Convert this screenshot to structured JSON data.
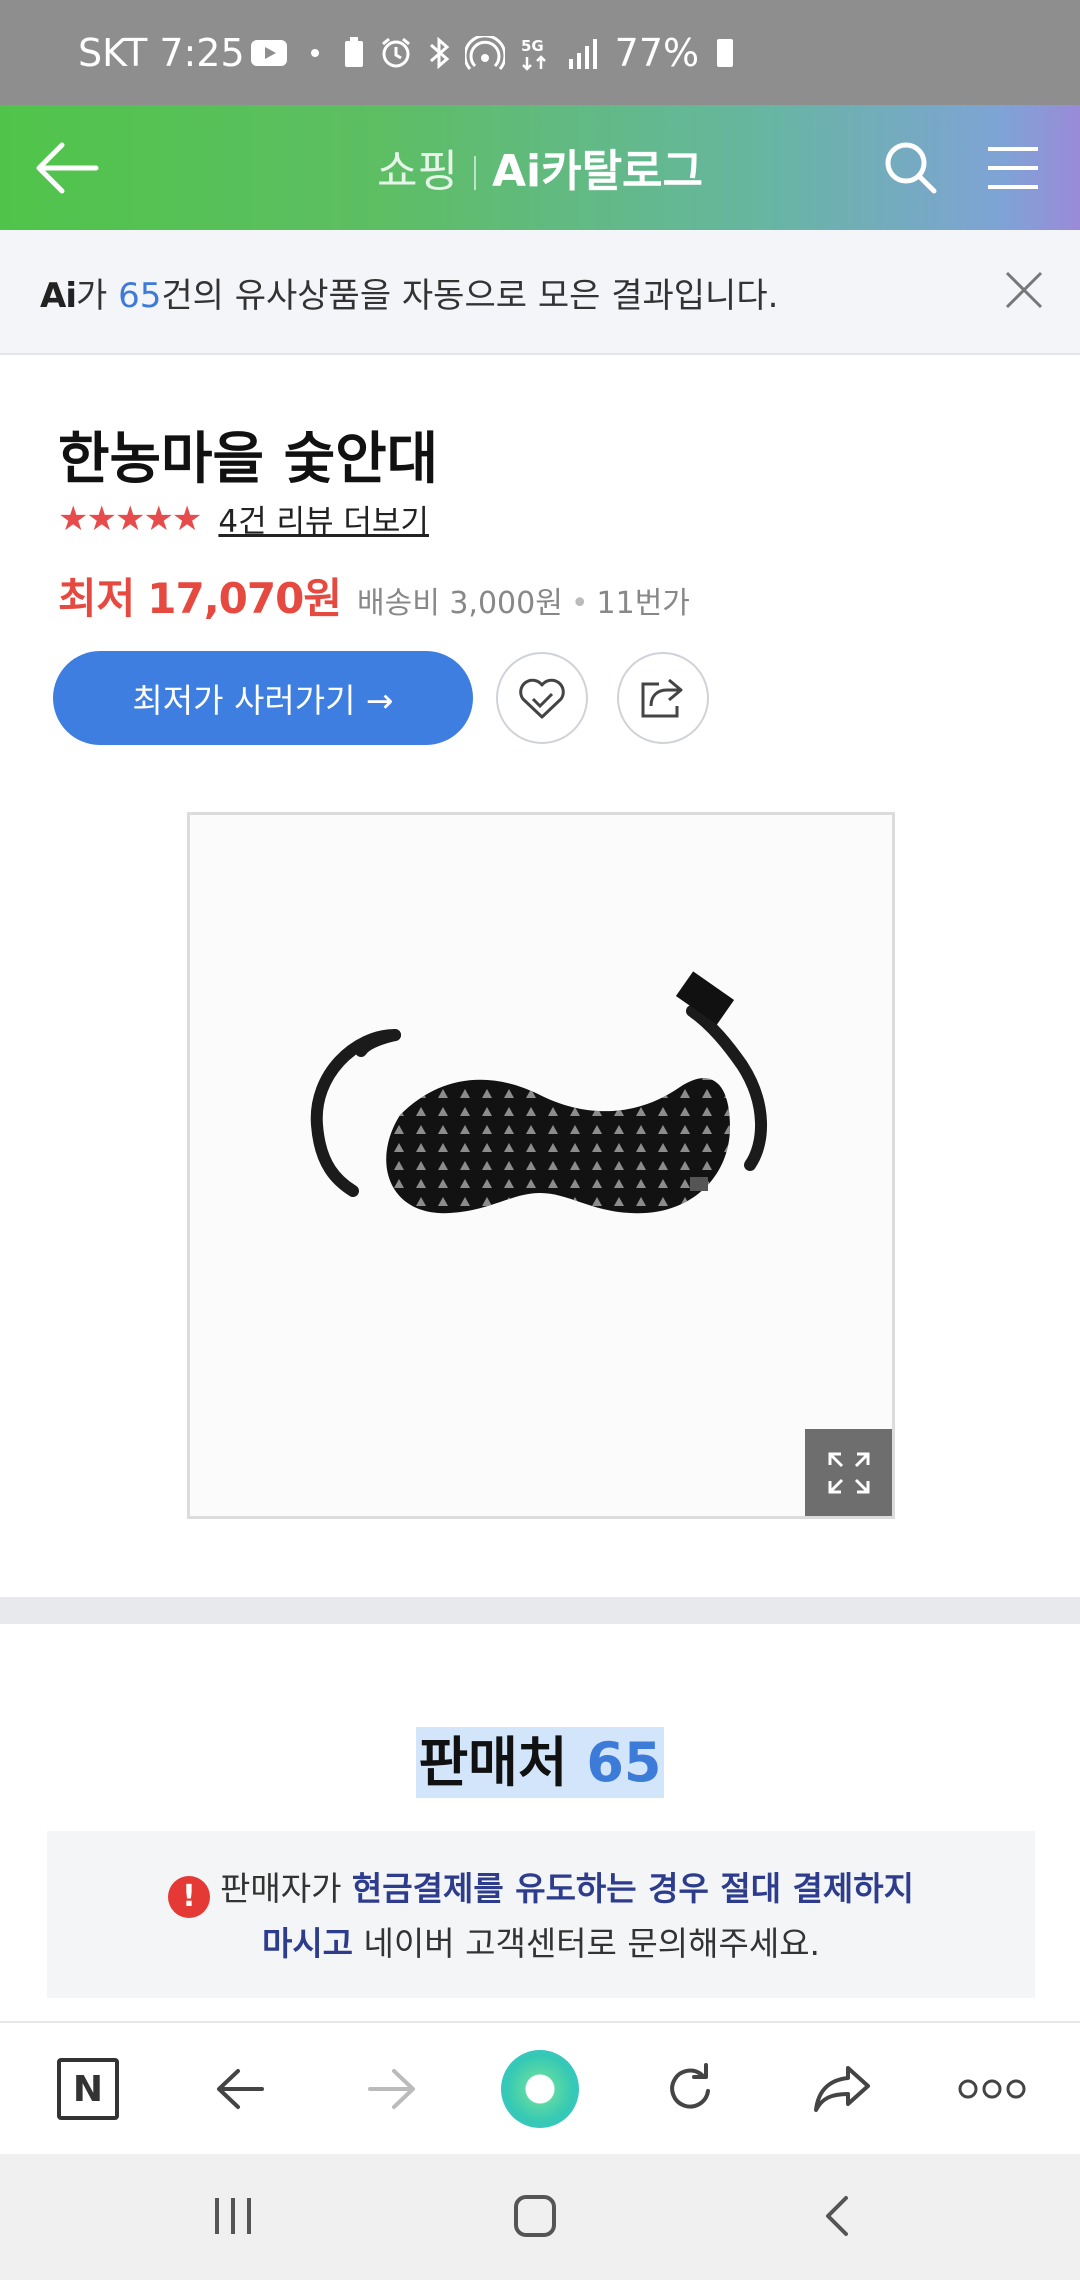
{
  "status_bar": {
    "carrier": "SKT",
    "time": "7:25",
    "battery": "77%",
    "icons": [
      "youtube-icon",
      "dot-icon",
      "battery-saver-icon",
      "alarm-icon",
      "bluetooth-icon",
      "hotspot-icon",
      "5g-icon",
      "signal-icon",
      "battery-icon"
    ]
  },
  "header": {
    "shop_label": "쇼핑",
    "title": "Ai카탈로그"
  },
  "notice": {
    "logo": "Ai",
    "prefix": "가 ",
    "count": "65",
    "suffix": "건의 유사상품을 자동으로 모은 결과입니다."
  },
  "product": {
    "title": "한농마을 숯안대",
    "stars": "★★★★★",
    "rating_value": 5,
    "review_link": "4건 리뷰 더보기",
    "price_label": "최저",
    "price_value": "17,070원",
    "shipping": "배송비 3,000원",
    "seller": "11번가",
    "buy_button": "최저가 사러가기 →"
  },
  "sellers": {
    "label": "판매처",
    "count": "65"
  },
  "warning": {
    "line1_prefix": "판매자가 ",
    "line1_emphasis": "현금결제를 유도하는 경우 절대 결제하지",
    "line2_emphasis": "마시고",
    "line2_suffix": " 네이버 고객센터로 문의해주세요."
  },
  "browser_toolbar": {
    "items": [
      "naver-home-icon",
      "back-arrow-icon",
      "forward-arrow-icon",
      "green-dot-icon",
      "refresh-icon",
      "share-icon",
      "more-icon"
    ]
  },
  "colors": {
    "accent_blue": "#3e7ee0",
    "price_red": "#e5493f",
    "header_green": "#50c44a"
  }
}
